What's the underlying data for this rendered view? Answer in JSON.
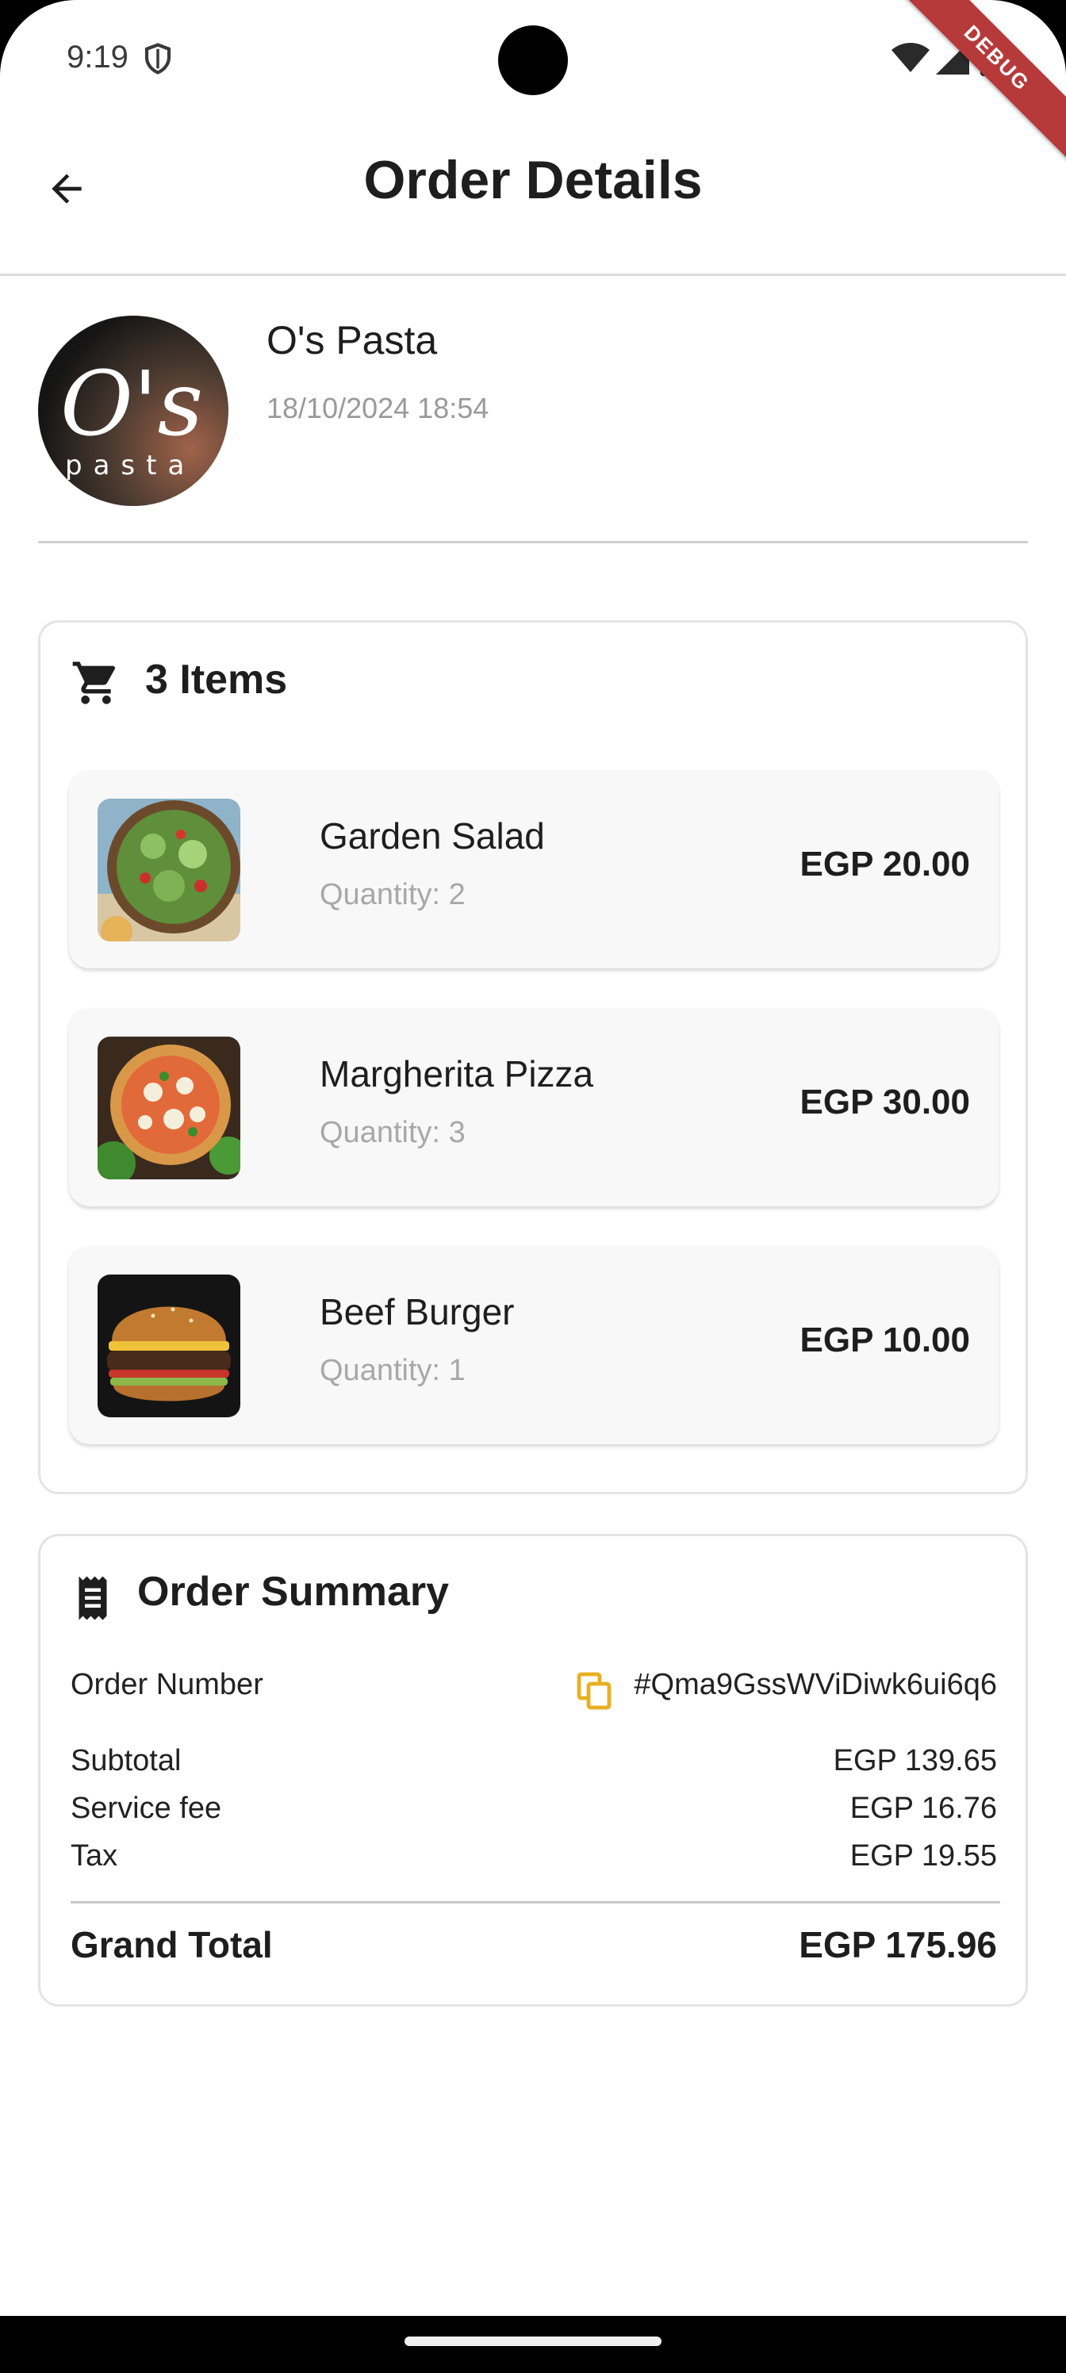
{
  "status_bar": {
    "time": "9:19",
    "debug_label": "DEBUG"
  },
  "app_bar": {
    "title": "Order Details",
    "back_icon": "arrow-back-icon"
  },
  "restaurant": {
    "name": "O's Pasta",
    "date": "18/10/2024 18:54",
    "logo_text_main": "O's",
    "logo_text_sub": "pasta"
  },
  "items_section": {
    "count_label": "3 Items",
    "icon": "cart-icon",
    "items": [
      {
        "name": "Garden Salad",
        "quantity": "Quantity: 2",
        "price": "EGP 20.00"
      },
      {
        "name": "Margherita Pizza",
        "quantity": "Quantity: 3",
        "price": "EGP 30.00"
      },
      {
        "name": "Beef Burger",
        "quantity": "Quantity: 1",
        "price": "EGP 10.00"
      }
    ]
  },
  "summary": {
    "title": "Order Summary",
    "icon": "receipt-icon",
    "order_number_label": "Order Number",
    "order_number": "#Qma9GssWViDiwk6ui6q6",
    "copy_icon_color": "#e8b020",
    "subtotal_label": "Subtotal",
    "subtotal": "EGP 139.65",
    "service_fee_label": "Service fee",
    "service_fee": "EGP 16.76",
    "tax_label": "Tax",
    "tax": "EGP 19.55",
    "grand_total_label": "Grand Total",
    "grand_total": "EGP 175.96"
  }
}
